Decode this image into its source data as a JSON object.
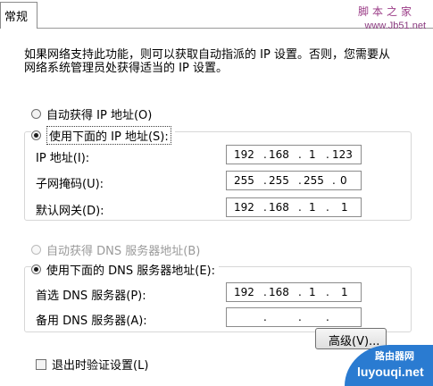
{
  "tab": {
    "label": "常规"
  },
  "watermark": {
    "site_cn": "脚本之家",
    "site_url": "www.Jb51.net",
    "logo_cn": "路由器网",
    "logo_url": "luyouqi.net"
  },
  "description": "如果网络支持此功能，则可以获取自动指派的 IP 设置。否则，您需要从网络系统管理员处获得适当的 IP 设置。",
  "ip": {
    "auto_label": "自动获得 IP 地址(O)",
    "manual_label": "使用下面的 IP 地址(S):",
    "address_label": "IP 地址(I):",
    "address": [
      "192",
      "168",
      "1",
      "123"
    ],
    "mask_label": "子网掩码(U):",
    "mask": [
      "255",
      "255",
      "255",
      "0"
    ],
    "gateway_label": "默认网关(D):",
    "gateway": [
      "192",
      "168",
      "1",
      "1"
    ]
  },
  "dns": {
    "auto_label": "自动获得 DNS 服务器地址(B)",
    "manual_label": "使用下面的 DNS 服务器地址(E):",
    "preferred_label": "首选 DNS 服务器(P):",
    "preferred": [
      "192",
      "168",
      "1",
      "1"
    ],
    "alternate_label": "备用 DNS 服务器(A):",
    "alternate": [
      "",
      "",
      "",
      ""
    ]
  },
  "validate_label": "退出时验证设置(L)",
  "advanced_label": "高级(V)..."
}
